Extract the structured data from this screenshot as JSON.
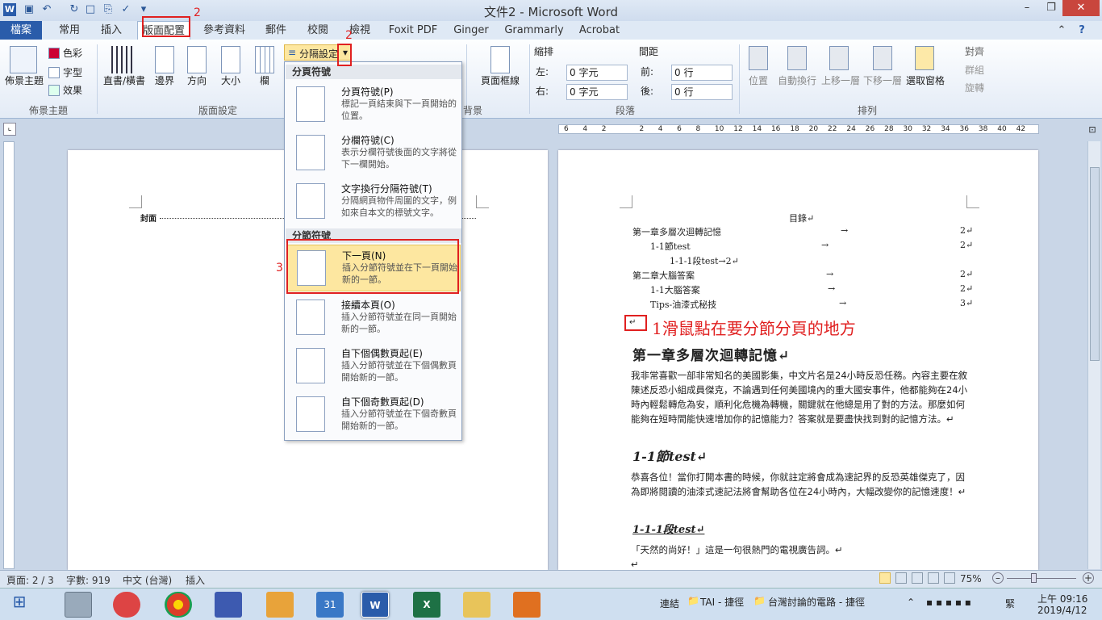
{
  "window": {
    "title": "文件2 - Microsoft Word",
    "help": "?"
  },
  "tabs": [
    "檔案",
    "常用",
    "插入",
    "版面配置",
    "參考資料",
    "郵件",
    "校閱",
    "檢視",
    "Foxit PDF",
    "Ginger",
    "Grammarly",
    "Acrobat"
  ],
  "ribbon": {
    "theme": {
      "btn": "佈景主題",
      "colors": "色彩",
      "fonts": "字型",
      "effects": "效果",
      "group": "佈景主題"
    },
    "page_setup": {
      "direction_text": "直書/橫書",
      "margins": "邊界",
      "orientation": "方向",
      "size": "大小",
      "columns": "欄",
      "breaks": "分隔設定",
      "group": "版面設定"
    },
    "background": {
      "borders": "頁面框線",
      "group": "背景"
    },
    "paragraph": {
      "indent_title": "縮排",
      "spacing_title": "間距",
      "left": "左:",
      "right": "右:",
      "before": "前:",
      "after": "後:",
      "left_val": "0 字元",
      "right_val": "0 字元",
      "before_val": "0 行",
      "after_val": "0 行",
      "group": "段落"
    },
    "arrange": {
      "position": "位置",
      "wrap": "自動換行",
      "forward": "上移一層",
      "backward": "下移一層",
      "pane": "選取窗格",
      "align": "對齊",
      "group_btn": "群組",
      "rotate": "旋轉",
      "group": "排列"
    }
  },
  "ruler_ticks": [
    "6",
    "4",
    "2",
    "",
    "2",
    "4",
    "6",
    "8",
    "10",
    "12",
    "14",
    "16",
    "18",
    "20",
    "22",
    "24",
    "26",
    "28",
    "30",
    "32",
    "34",
    "36",
    "38",
    "40",
    "42"
  ],
  "menu": {
    "section1": "分頁符號",
    "section2": "分節符號",
    "items": [
      {
        "title": "分頁符號(P)",
        "desc": "標記一頁結束與下一頁開始的位置。"
      },
      {
        "title": "分欄符號(C)",
        "desc": "表示分欄符號後面的文字將從下一欄開始。"
      },
      {
        "title": "文字換行分隔符號(T)",
        "desc": "分隔網頁物件周圍的文字，例如來自本文的標號文字。"
      },
      {
        "title": "下一頁(N)",
        "desc": "插入分節符號並在下一頁開始新的一節。"
      },
      {
        "title": "接續本頁(O)",
        "desc": "插入分節符號並在同一頁開始新的一節。"
      },
      {
        "title": "自下個偶數頁起(E)",
        "desc": "插入分節符號並在下個偶數頁開始新的一節。"
      },
      {
        "title": "自下個奇數頁起(D)",
        "desc": "插入分節符號並在下個奇數頁開始新的一節。"
      }
    ]
  },
  "annotations": {
    "n2a": "2",
    "n2b": "2",
    "n3": "3",
    "note1": "1滑鼠點在要分節分頁的地方"
  },
  "left_page": {
    "cover": "封面"
  },
  "right_page": {
    "toc_title": "目錄↵",
    "toc": [
      {
        "text": "第一章多層次迴轉記憶",
        "page": "2↵"
      },
      {
        "text": "1-1節test",
        "page": "2↵"
      },
      {
        "text": "1-1-1段test→2↵",
        "page": ""
      },
      {
        "text": "第二章大腦答案",
        "page": "2↵"
      },
      {
        "text": "1-1大腦答案",
        "page": "2↵"
      },
      {
        "text": "Tips-油漆式秘技",
        "page": "3↵"
      }
    ],
    "para_mark": "↵",
    "h1": "第一章多層次迴轉記憶↵",
    "p1": "我非常喜歡一部非常知名的美國影集，中文片名是24小時反恐任務。內容主要在敘陳述反恐小組成員傑克，不論遇到任何美國境內的重大國安事件，他都能夠在24小時內輕鬆轉危為安，順利化危機為轉機，關鍵就在他總是用了對的方法。那麼如何能夠在短時間能快速增加你的記憶能力？答案就是要盡快找到對的記憶方法。↵",
    "h2": "1-1節test↵",
    "p2": "恭喜各位！當你打開本書的時候，你就註定將會成為速記界的反恐英雄傑克了，因為即將閱讀的油漆式速記法將會幫助各位在24小時內，大幅改變你的記憶速度！↵",
    "h3": "1-1-1段test↵",
    "p3": "「天然的尚好！」這是一句很熱門的電視廣告詞。↵",
    "p4": "↵"
  },
  "status": {
    "page": "頁面: 2 / 3",
    "words": "字數: 919",
    "lang": "中文 (台灣)",
    "mode": "插入",
    "zoom": "75%"
  },
  "taskbar": {
    "links": "連結",
    "tai": "TAI - 捷徑",
    "forum": "台灣討論的電路 - 捷徑",
    "ime": "緊",
    "time": "上午 09:16",
    "date": "2019/4/12"
  }
}
